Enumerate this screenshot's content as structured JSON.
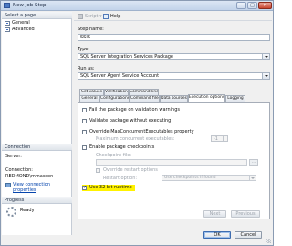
{
  "window": {
    "title": "New Job Step"
  },
  "left": {
    "select_page_header": "Select a page",
    "pages": [
      "General",
      "Advanced"
    ],
    "connection_header": "Connection",
    "server_label": "Server:",
    "connection_label": "Connection:",
    "connection_value": "REDMOND\\mmasson",
    "view_connection_link": "View connection properties",
    "progress_header": "Progress",
    "progress_status": "Ready"
  },
  "toolbar": {
    "script_label": "Script",
    "help_label": "Help"
  },
  "form": {
    "step_name_label": "Step name:",
    "step_name_value": "SSIS",
    "type_label": "Type:",
    "type_value": "SQL Server Integration Services Package",
    "run_as_label": "Run as:",
    "run_as_value": "SQL Server Agent Service Account"
  },
  "tabs": {
    "row1": [
      "Set values",
      "Verification",
      "Command line"
    ],
    "row2": [
      "General",
      "Configurations",
      "Command files",
      "Data sources",
      "Execution options",
      "Logging"
    ],
    "active": "Execution options"
  },
  "exec": {
    "fail_on_warnings": "Fail the package on validation warnings",
    "validate_without_executing": "Validate package without executing",
    "override_max_exec": "Override MaxConcurrentExecutables property",
    "max_concurrent_label": "Maximum concurrent executables:",
    "max_concurrent_value": "-1",
    "enable_checkpoints": "Enable package checkpoints",
    "checkpoint_file_label": "Checkpoint file:",
    "browse_label": "...",
    "override_restart": "Override restart options",
    "restart_option_label": "Restart option:",
    "restart_option_value": "Use checkpoints if found",
    "use_32bit": "Use 32 bit runtime",
    "checked": {
      "use_32bit": true
    }
  },
  "buttons": {
    "next": "Next",
    "previous": "Previous",
    "ok": "OK",
    "cancel": "Cancel"
  }
}
